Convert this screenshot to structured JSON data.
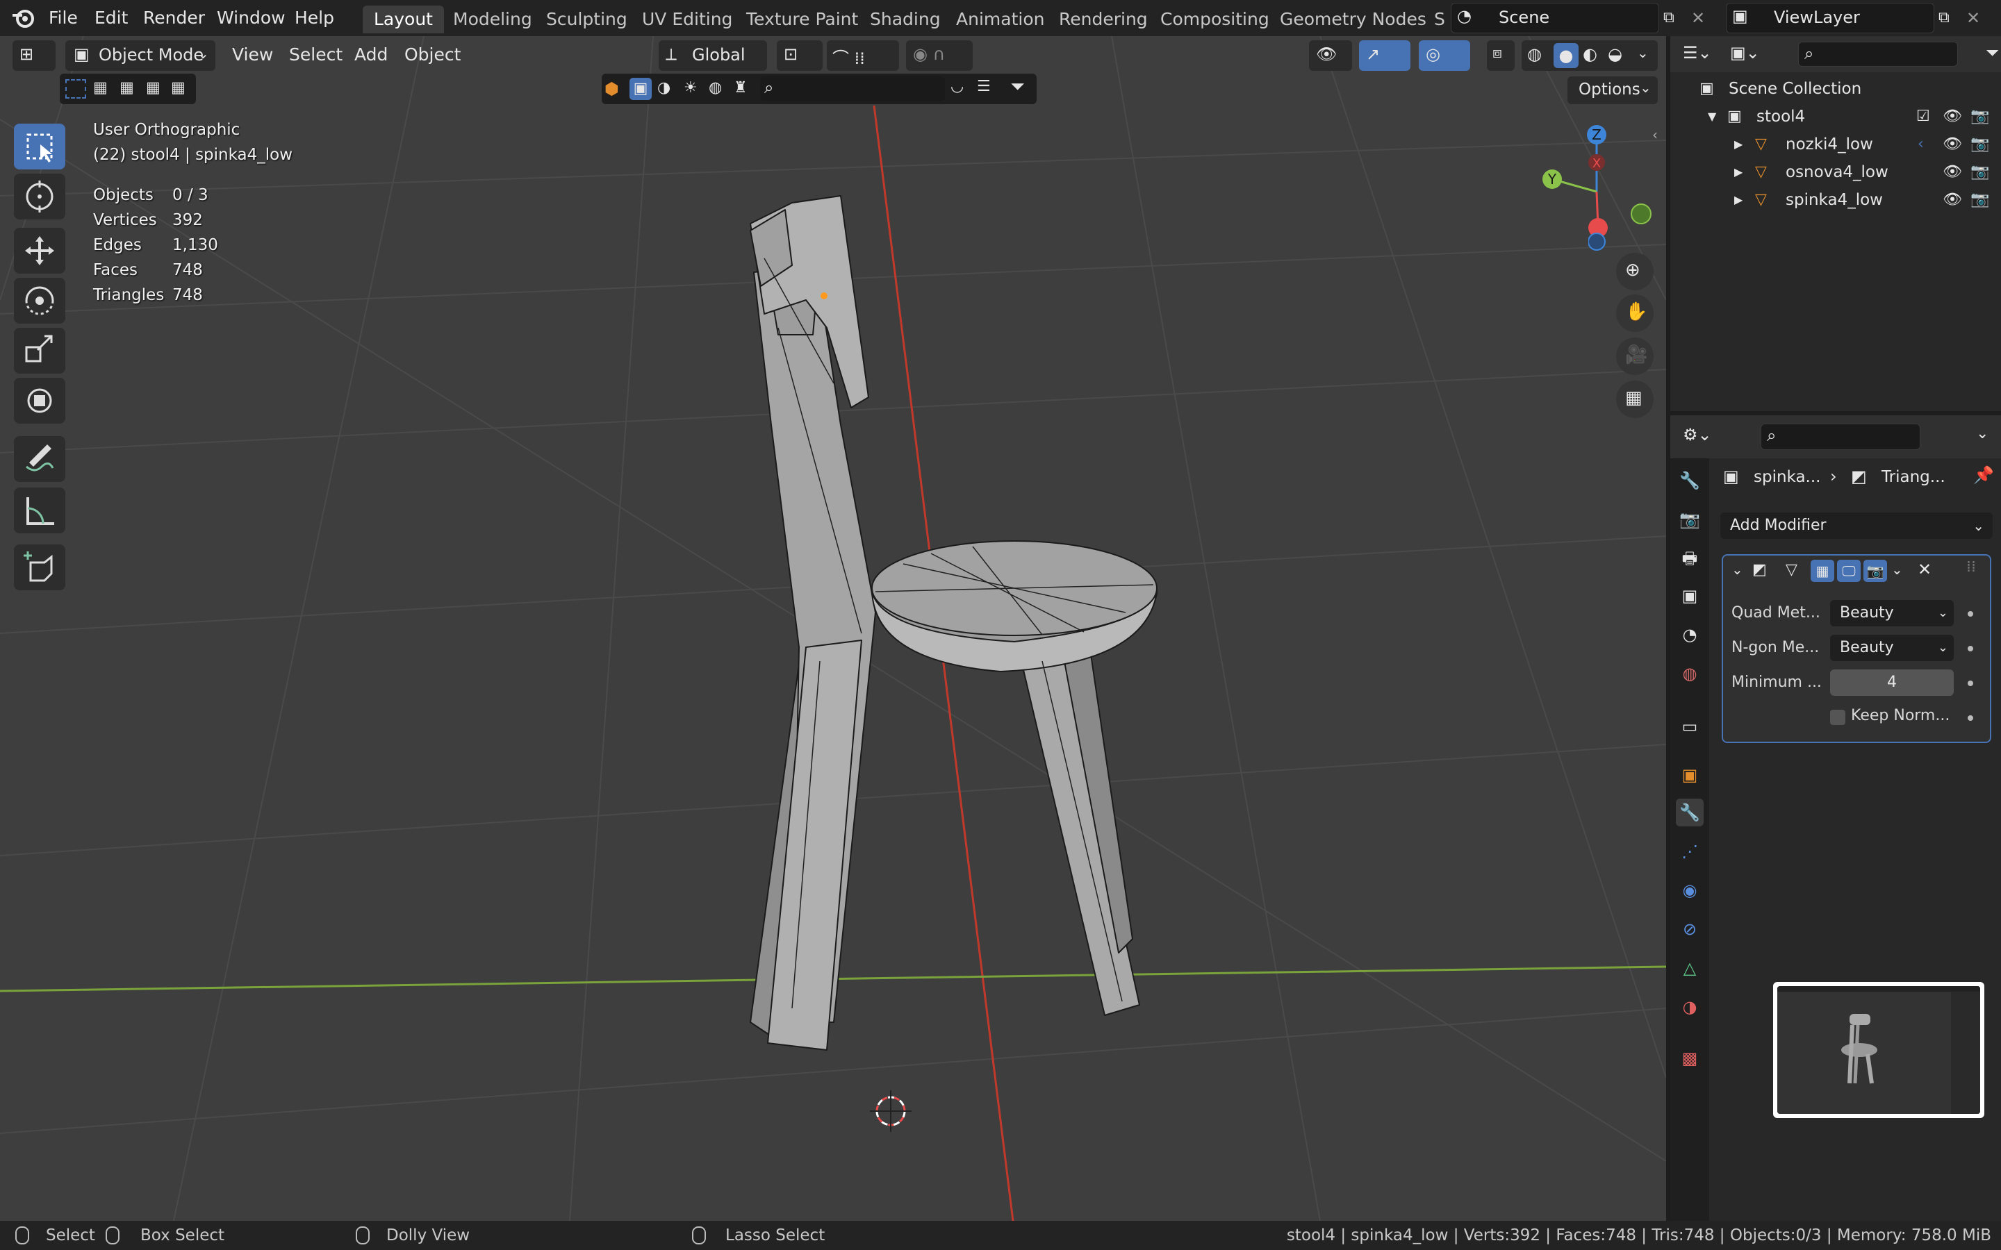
{
  "menu": {
    "items": [
      "File",
      "Edit",
      "Render",
      "Window",
      "Help"
    ]
  },
  "workspaces": {
    "tabs": [
      "Layout",
      "Modeling",
      "Sculpting",
      "UV Editing",
      "Texture Paint",
      "Shading",
      "Animation",
      "Rendering",
      "Compositing",
      "Geometry Nodes",
      "S"
    ],
    "active": "Layout"
  },
  "scene": {
    "name": "Scene"
  },
  "view_layer": {
    "name": "ViewLayer"
  },
  "viewport_header": {
    "mode": "Object Mode",
    "menus": [
      "View",
      "Select",
      "Add",
      "Object"
    ],
    "orientation": "Global",
    "options_label": "Options"
  },
  "viewport_info": {
    "view_name": "User Orthographic",
    "context": "(22) stool4 | spinka4_low",
    "stats": [
      {
        "label": "Objects",
        "value": "0 / 3"
      },
      {
        "label": "Vertices",
        "value": "392"
      },
      {
        "label": "Edges",
        "value": "1,130"
      },
      {
        "label": "Faces",
        "value": "748"
      },
      {
        "label": "Triangles",
        "value": "748"
      }
    ]
  },
  "gizmo": {
    "z": "Z",
    "y": "Y",
    "x": "X"
  },
  "outliner": {
    "root": "Scene Collection",
    "collection": "stool4",
    "objects": [
      "nozki4_low",
      "osnova4_low",
      "spinka4_low"
    ]
  },
  "properties": {
    "breadcrumb_object": "spinka...",
    "breadcrumb_modifier": "Triang...",
    "add_modifier": "Add Modifier",
    "fields": [
      {
        "label": "Quad Met...",
        "value": "Beauty"
      },
      {
        "label": "N-gon Me...",
        "value": "Beauty"
      },
      {
        "label": "Minimum ...",
        "value": "4"
      }
    ],
    "keep_normals": "Keep Norm..."
  },
  "statusbar": {
    "select": "Select",
    "box_select": "Box Select",
    "dolly_view": "Dolly View",
    "lasso_select": "Lasso Select",
    "info": "stool4 | spinka4_low | Verts:392 | Faces:748 | Tris:748 | Objects:0/3 | Memory: 758.0 MiB"
  },
  "colors": {
    "accent": "#4772b3",
    "axis_x": "#e84b4b",
    "axis_y": "#8bc34a",
    "axis_z": "#3d85d8"
  }
}
